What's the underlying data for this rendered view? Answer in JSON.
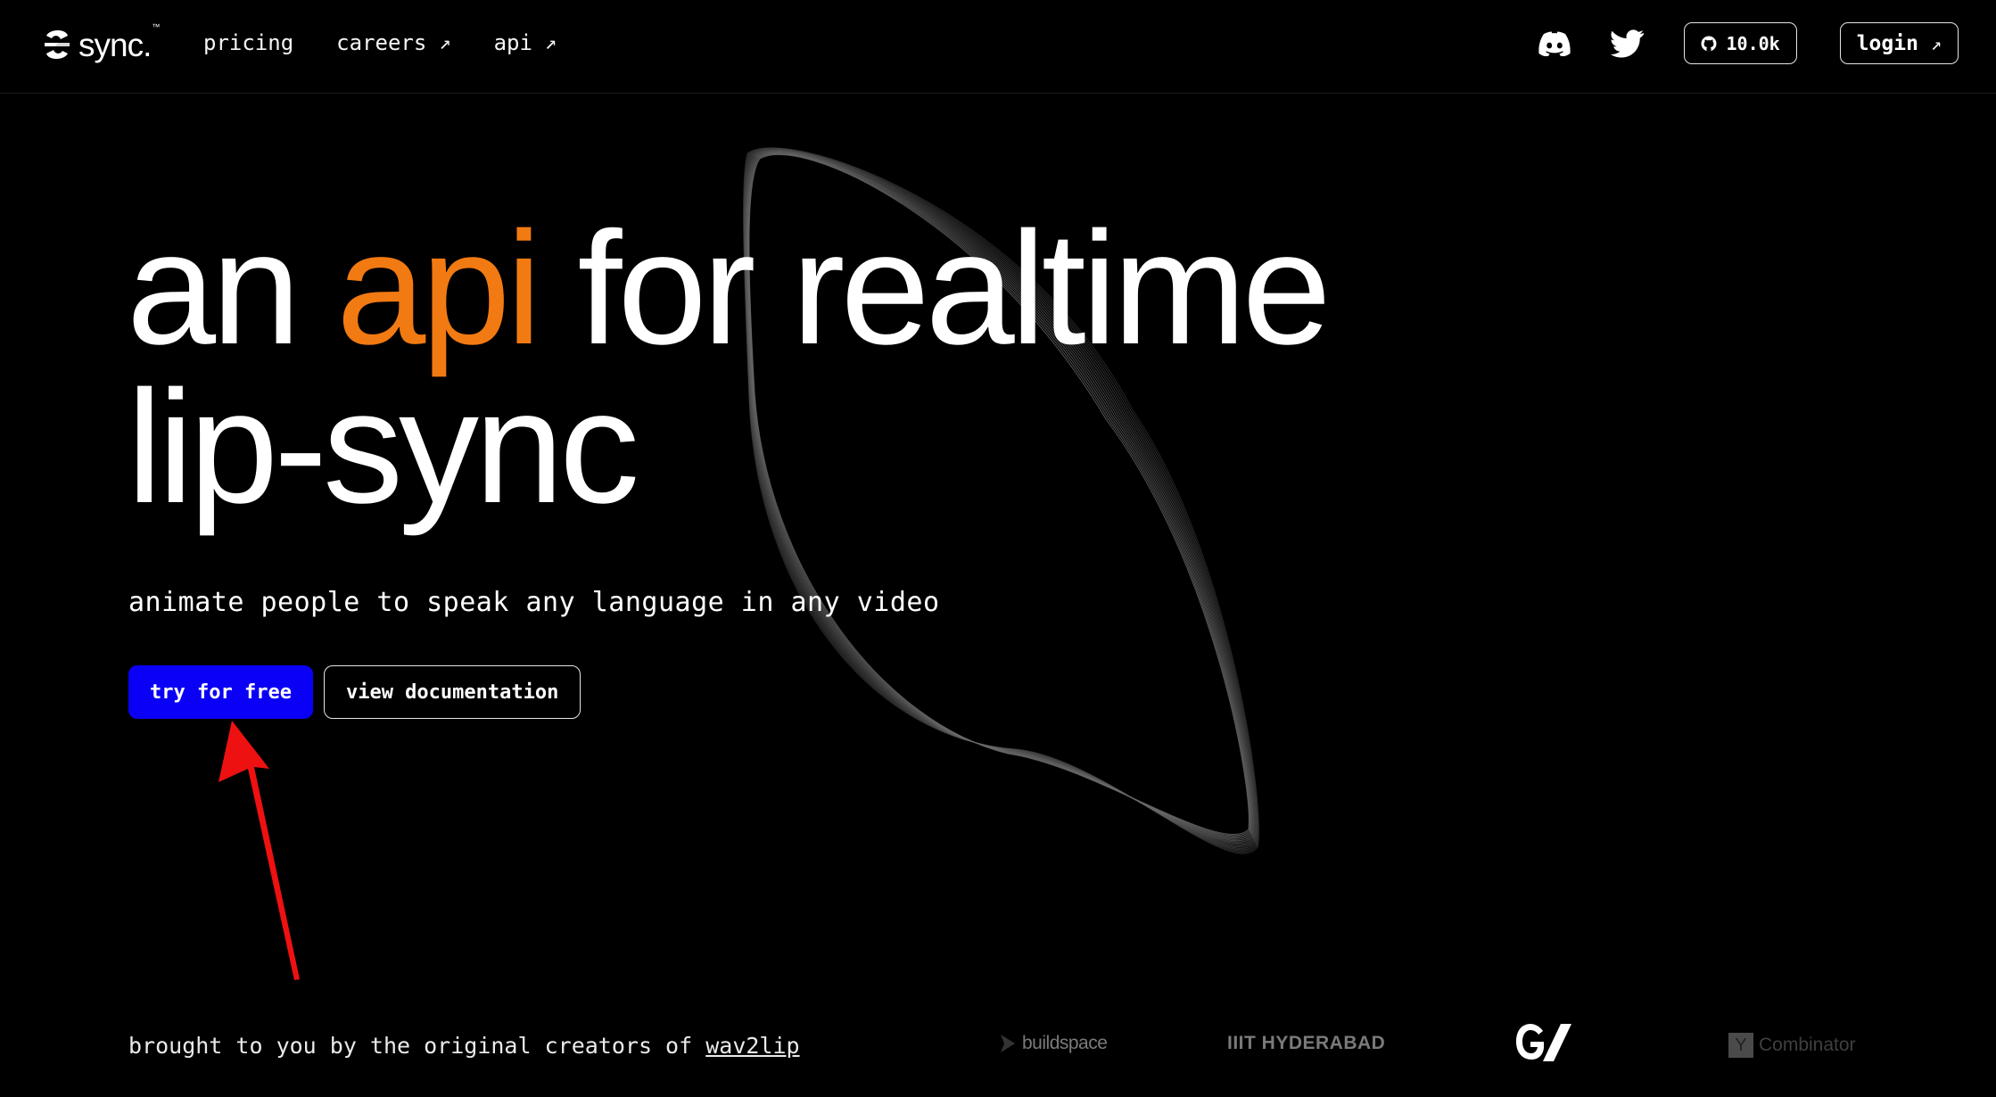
{
  "brand": {
    "name": "sync.",
    "tm": "™"
  },
  "nav": {
    "links": [
      {
        "label": "pricing",
        "external": false
      },
      {
        "label": "careers",
        "external": true
      },
      {
        "label": "api",
        "external": true
      }
    ],
    "external_arrow": "↗",
    "github_stars": "10.0k",
    "login_label": "login"
  },
  "hero": {
    "headline_word1": "an",
    "headline_accent": "api",
    "headline_rest": "for realtime",
    "headline_line2": "lip-sync",
    "subtitle": "animate people to speak any language in any video",
    "cta_primary": "try for free",
    "cta_secondary": "view documentation"
  },
  "credits": {
    "prefix": "brought to you by the original creators of",
    "link": "wav2lip"
  },
  "partners": {
    "buildspace": "buildspace",
    "iiit": "IIIT HYDERABAD",
    "gv": "GV",
    "yc_letter": "Y",
    "yc": "Combinator"
  },
  "colors": {
    "background": "#000000",
    "accent": "#f27a12",
    "primary_button": "#0a00f5",
    "annotation": "#ee1111"
  }
}
